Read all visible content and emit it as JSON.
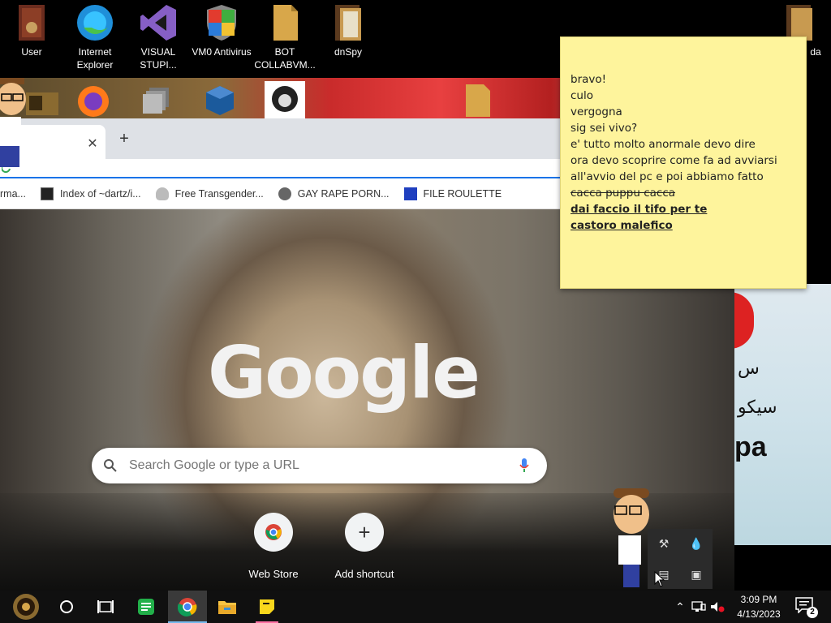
{
  "desktop_icons": [
    {
      "name": "user-icon",
      "label": "User"
    },
    {
      "name": "internet-explorer-icon",
      "label": "Internet Explorer"
    },
    {
      "name": "visual-studio-icon",
      "label": "VISUAL STUPI..."
    },
    {
      "name": "antivirus-icon",
      "label": "VM0 Antivirus"
    },
    {
      "name": "bot-collab-icon",
      "label": "BOT COLLABVM..."
    },
    {
      "name": "dnspy-icon",
      "label": "dnSpy"
    }
  ],
  "desktop_partial_label": "da",
  "chrome": {
    "bookmarks": [
      {
        "label": "rma..."
      },
      {
        "label": "Index of ~dartz/i..."
      },
      {
        "label": "Free Transgender..."
      },
      {
        "label": "GAY RAPE PORN..."
      },
      {
        "label": "FILE ROULETTE"
      }
    ],
    "google_logo": "Google",
    "search_placeholder": "Search Google or type a URL",
    "shortcuts": [
      {
        "label": "Web Store"
      },
      {
        "label": "Add shortcut"
      }
    ]
  },
  "background_text": {
    "arabic_top": "س",
    "arabic_mid": "سيكو",
    "latin": "pa"
  },
  "sticky_note": {
    "lines": [
      {
        "text": "bravo!",
        "style": "normal"
      },
      {
        "text": "culo",
        "style": "normal"
      },
      {
        "text": "vergogna",
        "style": "normal"
      },
      {
        "text": "sig sei vivo?",
        "style": "normal"
      },
      {
        "text": "e' tutto molto anormale devo dire",
        "style": "normal"
      },
      {
        "text": "ora devo scoprire come fa ad avviarsi",
        "style": "normal"
      },
      {
        "text": "all'avvio del pc e poi abbiamo fatto",
        "style": "normal"
      },
      {
        "text": "cacca puppu cacca",
        "style": "strike"
      },
      {
        "text": "dai faccio il tifo per te",
        "style": "bold-underline"
      },
      {
        "text": "castoro malefico",
        "style": "bold-underline"
      }
    ]
  },
  "taskbar": {
    "time": "3:09 PM",
    "date": "4/13/2023",
    "notification_count": "2"
  },
  "colors": {
    "sticky": "#fef49c",
    "taskbar": "#101010",
    "accent": "#1a73e8"
  }
}
